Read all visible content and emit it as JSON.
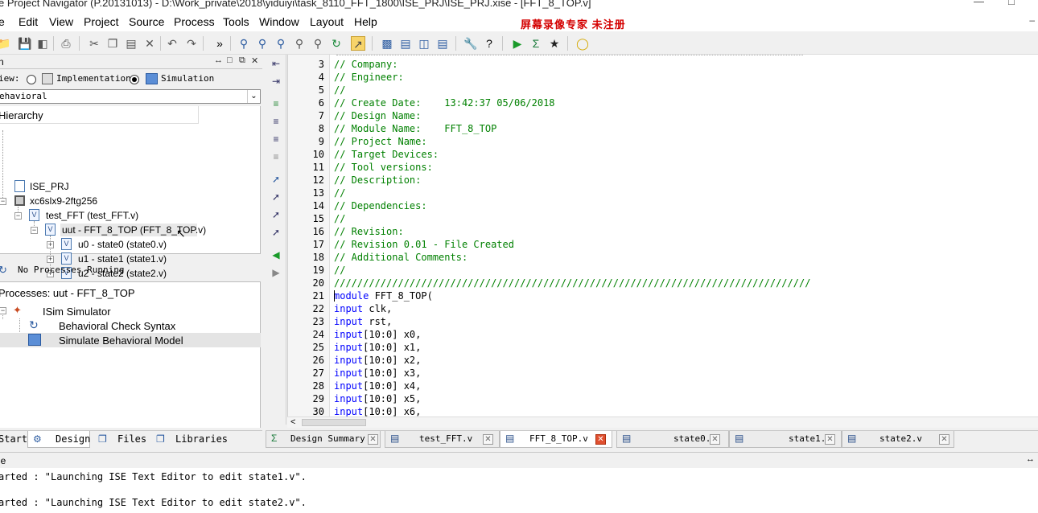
{
  "window": {
    "title": "e Project Navigator (P.20131013) - D:\\Work_private\\2018\\yiduiyi\\task_8110_FFT_1800\\ISE_PRJ\\ISE_PRJ.xise - [FFT_8_TOP.v]"
  },
  "menu": {
    "items": [
      "e",
      "Edit",
      "View",
      "Project",
      "Source",
      "Process",
      "Tools",
      "Window",
      "Layout",
      "Help"
    ],
    "watermark": "屏幕录像专家  未注册"
  },
  "design_panel": {
    "header": "n",
    "view_label": "iew:",
    "implementation_label": "Implementation",
    "simulation_label": "Simulation",
    "selected_view": "Simulation",
    "combo_value": "ehavioral",
    "hierarchy_header": "Hierarchy",
    "tree": [
      {
        "label": "ISE_PRJ",
        "icon": "project-icon"
      },
      {
        "label": "xc6slx9-2ftg256",
        "icon": "chip-icon"
      },
      {
        "label": "test_FFT (test_FFT.v)",
        "icon": "verilog-file-icon"
      },
      {
        "label": "uut - FFT_8_TOP (FFT_8_TOP.v)",
        "icon": "verilog-file-icon"
      },
      {
        "label": "u0 - state0 (state0.v)",
        "icon": "verilog-file-icon"
      },
      {
        "label": "u1 - state1 (state1.v)",
        "icon": "verilog-file-icon"
      },
      {
        "label": "u2 - state2 (state2.v)",
        "icon": "verilog-file-icon"
      }
    ],
    "status": "No Processes Running",
    "processes_header": "Processes: uut - FFT_8_TOP",
    "processes": [
      {
        "label": "ISim Simulator"
      },
      {
        "label": "Behavioral Check Syntax"
      },
      {
        "label": "Simulate Behavioral Model"
      }
    ]
  },
  "left_tabs": [
    {
      "label": "Start"
    },
    {
      "label": "Design"
    },
    {
      "label": "Files"
    },
    {
      "label": "Libraries"
    }
  ],
  "editor": {
    "lines": [
      {
        "n": "3",
        "text": "// Company:",
        "type": "comment"
      },
      {
        "n": "4",
        "text": "// Engineer:",
        "type": "comment"
      },
      {
        "n": "5",
        "text": "//",
        "type": "comment"
      },
      {
        "n": "6",
        "text": "// Create Date:    13:42:37 05/06/2018",
        "type": "comment"
      },
      {
        "n": "7",
        "text": "// Design Name:",
        "type": "comment"
      },
      {
        "n": "8",
        "text": "// Module Name:    FFT_8_TOP",
        "type": "comment"
      },
      {
        "n": "9",
        "text": "// Project Name:",
        "type": "comment"
      },
      {
        "n": "10",
        "text": "// Target Devices:",
        "type": "comment"
      },
      {
        "n": "11",
        "text": "// Tool versions:",
        "type": "comment"
      },
      {
        "n": "12",
        "text": "// Description:",
        "type": "comment"
      },
      {
        "n": "13",
        "text": "//",
        "type": "comment"
      },
      {
        "n": "14",
        "text": "// Dependencies:",
        "type": "comment"
      },
      {
        "n": "15",
        "text": "//",
        "type": "comment"
      },
      {
        "n": "16",
        "text": "// Revision:",
        "type": "comment"
      },
      {
        "n": "17",
        "text": "// Revision 0.01 - File Created",
        "type": "comment"
      },
      {
        "n": "18",
        "text": "// Additional Comments:",
        "type": "comment"
      },
      {
        "n": "19",
        "text": "//",
        "type": "comment"
      },
      {
        "n": "20",
        "text": "//////////////////////////////////////////////////////////////////////////////////",
        "type": "comment"
      },
      {
        "n": "21",
        "kw": "module",
        "rest": " FFT_8_TOP(",
        "type": "code"
      },
      {
        "n": "22",
        "kw": "input",
        "rest": " clk,",
        "type": "code"
      },
      {
        "n": "23",
        "kw": "input",
        "rest": " rst,",
        "type": "code"
      },
      {
        "n": "24",
        "kw": "input",
        "rest": "[10:0] x0,",
        "type": "code"
      },
      {
        "n": "25",
        "kw": "input",
        "rest": "[10:0] x1,",
        "type": "code"
      },
      {
        "n": "26",
        "kw": "input",
        "rest": "[10:0] x2,",
        "type": "code"
      },
      {
        "n": "27",
        "kw": "input",
        "rest": "[10:0] x3,",
        "type": "code"
      },
      {
        "n": "28",
        "kw": "input",
        "rest": "[10:0] x4,",
        "type": "code"
      },
      {
        "n": "29",
        "kw": "input",
        "rest": "[10:0] x5,",
        "type": "code"
      },
      {
        "n": "30",
        "kw": "input",
        "rest": "[10:0] x6,",
        "type": "code"
      }
    ]
  },
  "editor_tabs": [
    {
      "label": "Design Summary",
      "active": false
    },
    {
      "label": "test_FFT.v",
      "active": false
    },
    {
      "label": "FFT_8_TOP.v",
      "active": true
    },
    {
      "label": "state0.v",
      "active": false
    },
    {
      "label": "state1.v",
      "active": false
    },
    {
      "label": "state2.v",
      "active": false
    }
  ],
  "console": {
    "header": "le",
    "lines": [
      "arted : \"Launching ISE Text Editor to edit state1.v\".",
      "arted : \"Launching ISE Text Editor to edit state2.v\"."
    ]
  }
}
